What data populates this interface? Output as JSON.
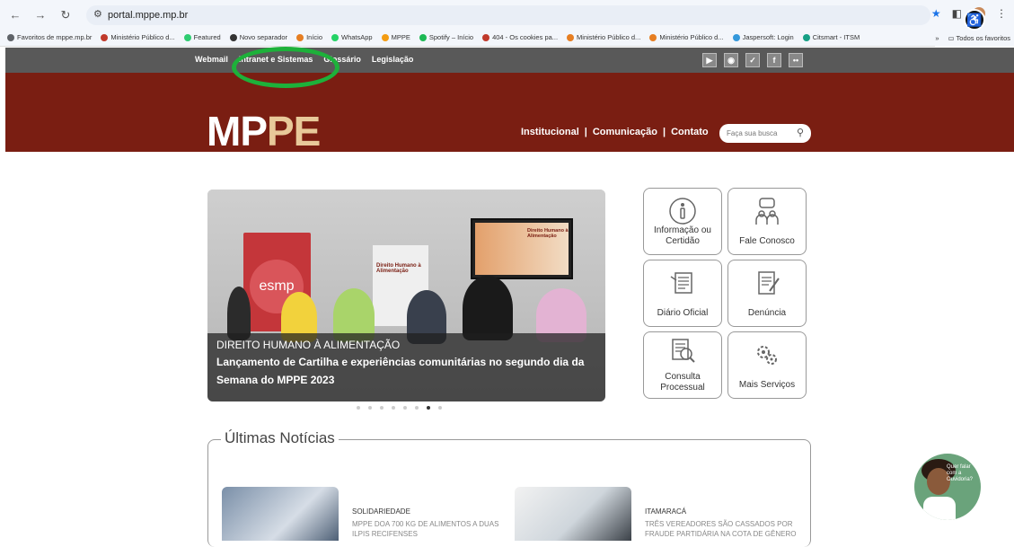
{
  "browser": {
    "url": "portal.mppe.mp.br",
    "bookmarks": [
      {
        "label": "Favoritos de mppe.mp.br",
        "color": "#5f6368"
      },
      {
        "label": "Ministério Público d...",
        "color": "#c0392b"
      },
      {
        "label": "Featured",
        "color": "#2ecc71"
      },
      {
        "label": "Novo separador",
        "color": "#333333"
      },
      {
        "label": "Início",
        "color": "#e67e22"
      },
      {
        "label": "WhatsApp",
        "color": "#25d366"
      },
      {
        "label": "MPPE",
        "color": "#f39c12"
      },
      {
        "label": "Spotify – Início",
        "color": "#1db954"
      },
      {
        "label": "404 - Os cookies pa...",
        "color": "#c0392b"
      },
      {
        "label": "Ministério Público d...",
        "color": "#e67e22"
      },
      {
        "label": "Ministério Público d...",
        "color": "#e67e22"
      },
      {
        "label": "Jaspersoft: Login",
        "color": "#3498db"
      },
      {
        "label": "Citsmart - ITSM",
        "color": "#16a085"
      }
    ],
    "more_bookmarks": "»",
    "all_bookmarks": "Todos os favoritos"
  },
  "site": {
    "top_links": [
      "Webmail",
      "Intranet e Sistemas",
      "Glossário",
      "Legislação"
    ],
    "social": [
      "▶",
      "◉",
      "✓",
      "f",
      "••"
    ],
    "logo_mp": "MP",
    "logo_pe": "PE",
    "nav": [
      "Institucional",
      "|",
      "Comunicação",
      "|",
      "Contato"
    ],
    "search_placeholder": "Faça sua busca"
  },
  "carousel": {
    "banner_esmp": "esmp",
    "banner_text": "Direito Humano à Alimentação",
    "tv_text": "Direito Humano à Alimentação",
    "kicker": "DIREITO HUMANO À ALIMENTAÇÃO",
    "title_line1": "Lançamento de Cartilha e experiências comunitárias no segundo dia da",
    "title_line2": "Semana do MPPE 2023",
    "active_dot": 6,
    "dot_count": 8
  },
  "tiles": [
    {
      "label": "Informação ou Certidão",
      "icon": "info-icon"
    },
    {
      "label": "Fale Conosco",
      "icon": "chat-icon"
    },
    {
      "label": "Diário Oficial",
      "icon": "newspaper-icon"
    },
    {
      "label": "Denúncia",
      "icon": "document-edit-icon"
    },
    {
      "label": "Consulta Processual",
      "icon": "magnifier-document-icon"
    },
    {
      "label": "Mais Serviços",
      "icon": "gears-icon"
    }
  ],
  "news": {
    "section_title": "Últimas Notícias",
    "items": [
      {
        "kicker": "SOLIDARIEDADE",
        "text": "MPPE DOA 700 KG DE ALIMENTOS A DUAS ILPIS RECIFENSES"
      },
      {
        "kicker": "ITAMARACÁ",
        "text": "TRÊS VEREADORES SÃO CASSADOS POR FRAUDE PARTIDÁRIA NA COTA DE GÊNERO"
      }
    ]
  },
  "ouvidoria": {
    "bubble": "Quer falar com a Ouvidoria?"
  }
}
